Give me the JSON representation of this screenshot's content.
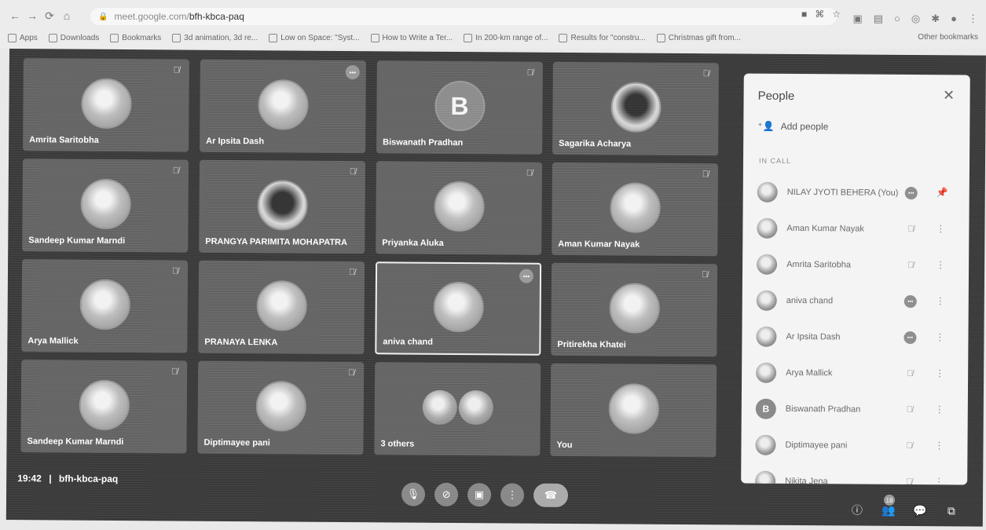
{
  "browser": {
    "url_host": "meet.google.com/",
    "url_path": "bfh-kbca-paq",
    "bookmarks": [
      {
        "label": "Apps",
        "icon": "apps-icon"
      },
      {
        "label": "Downloads",
        "icon": "download-icon"
      },
      {
        "label": "Bookmarks",
        "icon": "star-icon"
      },
      {
        "label": "3d animation, 3d re...",
        "icon": "page-icon"
      },
      {
        "label": "Low on Space: \"Syst...",
        "icon": "page-icon"
      },
      {
        "label": "How to Write a Ter...",
        "icon": "page-icon"
      },
      {
        "label": "In 200-km range of...",
        "icon": "page-icon"
      },
      {
        "label": "Results for \"constru...",
        "icon": "e-icon"
      },
      {
        "label": "Christmas gift from...",
        "icon": "page-icon"
      }
    ],
    "other_bookmarks": "Other bookmarks"
  },
  "tiles": [
    {
      "name": "Amrita Saritobha",
      "status": "muted"
    },
    {
      "name": "Ar Ipsita Dash",
      "status": "speaking"
    },
    {
      "name": "Biswanath Pradhan",
      "status": "muted",
      "letter": "B"
    },
    {
      "name": "Sagarika Acharya",
      "status": "muted"
    },
    {
      "name": "Sandeep Kumar Marndi",
      "status": "muted"
    },
    {
      "name": "PRANGYA PARIMITA MOHAPATRA",
      "status": "muted"
    },
    {
      "name": "Priyanka Aluka",
      "status": "muted"
    },
    {
      "name": "Aman Kumar Nayak",
      "status": "muted"
    },
    {
      "name": "Arya Mallick",
      "status": "muted"
    },
    {
      "name": "PRANAYA LENKA",
      "status": "muted"
    },
    {
      "name": "aniva chand",
      "status": "speaking"
    },
    {
      "name": "Pritirekha Khatei",
      "status": "muted"
    },
    {
      "name": "Sandeep Kumar Marndi",
      "status": "muted"
    },
    {
      "name": "Diptimayee pani",
      "status": "muted"
    },
    {
      "name": "3 others",
      "status": "none"
    },
    {
      "name": "You",
      "status": "none"
    }
  ],
  "panel": {
    "title": "People",
    "add_people": "Add people",
    "section": "IN CALL",
    "participants": [
      {
        "name": "NILAY JYOTI BEHERA (You)",
        "status": "speaking"
      },
      {
        "name": "Aman Kumar Nayak",
        "status": "muted"
      },
      {
        "name": "Amrita Saritobha",
        "status": "muted"
      },
      {
        "name": "aniva chand",
        "status": "speaking"
      },
      {
        "name": "Ar Ipsita Dash",
        "status": "speaking"
      },
      {
        "name": "Arya Mallick",
        "status": "muted"
      },
      {
        "name": "Biswanath Pradhan",
        "status": "muted",
        "letter": "B"
      },
      {
        "name": "Diptimayee pani",
        "status": "muted"
      },
      {
        "name": "Nikita Jena",
        "status": "muted"
      }
    ]
  },
  "meeting": {
    "time": "19:42",
    "separator": "|",
    "code": "bfh-kbca-paq",
    "participant_count": "18"
  }
}
